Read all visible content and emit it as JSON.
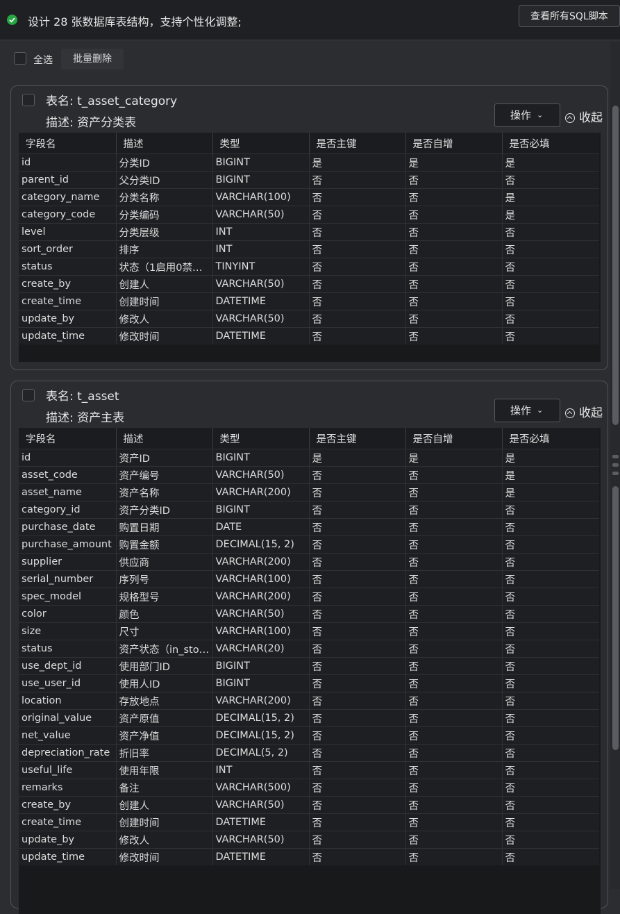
{
  "header": {
    "title": "设计 28 张数据库表结构，支持个性化调整;",
    "sql_button": "查看所有SQL脚本",
    "status_icon": "check-circle-icon",
    "status_color": "#27a644"
  },
  "toolbar": {
    "select_all": "全选",
    "batch_delete": "批量删除"
  },
  "columns": [
    "字段名",
    "描述",
    "类型",
    "是否主键",
    "是否自增",
    "是否必填"
  ],
  "tables": [
    {
      "name_label": "表名: t_asset_category",
      "desc_label": "描述: 资产分类表",
      "operate": "操作",
      "collapse": "收起",
      "rows": [
        [
          "id",
          "分类ID",
          "BIGINT",
          "是",
          "是",
          "是"
        ],
        [
          "parent_id",
          "父分类ID",
          "BIGINT",
          "否",
          "否",
          "否"
        ],
        [
          "category_name",
          "分类名称",
          "VARCHAR(100)",
          "否",
          "否",
          "是"
        ],
        [
          "category_code",
          "分类编码",
          "VARCHAR(50)",
          "否",
          "否",
          "是"
        ],
        [
          "level",
          "分类层级",
          "INT",
          "否",
          "否",
          "否"
        ],
        [
          "sort_order",
          "排序",
          "INT",
          "否",
          "否",
          "否"
        ],
        [
          "status",
          "状态（1启用0禁用…",
          "TINYINT",
          "否",
          "否",
          "否"
        ],
        [
          "create_by",
          "创建人",
          "VARCHAR(50)",
          "否",
          "否",
          "否"
        ],
        [
          "create_time",
          "创建时间",
          "DATETIME",
          "否",
          "否",
          "否"
        ],
        [
          "update_by",
          "修改人",
          "VARCHAR(50)",
          "否",
          "否",
          "否"
        ],
        [
          "update_time",
          "修改时间",
          "DATETIME",
          "否",
          "否",
          "否"
        ]
      ]
    },
    {
      "name_label": "表名: t_asset",
      "desc_label": "描述: 资产主表",
      "operate": "操作",
      "collapse": "收起",
      "rows": [
        [
          "id",
          "资产ID",
          "BIGINT",
          "是",
          "是",
          "是"
        ],
        [
          "asset_code",
          "资产编号",
          "VARCHAR(50)",
          "否",
          "否",
          "是"
        ],
        [
          "asset_name",
          "资产名称",
          "VARCHAR(200)",
          "否",
          "否",
          "是"
        ],
        [
          "category_id",
          "资产分类ID",
          "BIGINT",
          "否",
          "否",
          "否"
        ],
        [
          "purchase_date",
          "购置日期",
          "DATE",
          "否",
          "否",
          "否"
        ],
        [
          "purchase_amount",
          "购置金额",
          "DECIMAL(15, 2)",
          "否",
          "否",
          "否"
        ],
        [
          "supplier",
          "供应商",
          "VARCHAR(200)",
          "否",
          "否",
          "否"
        ],
        [
          "serial_number",
          "序列号",
          "VARCHAR(100)",
          "否",
          "否",
          "否"
        ],
        [
          "spec_model",
          "规格型号",
          "VARCHAR(200)",
          "否",
          "否",
          "否"
        ],
        [
          "color",
          "颜色",
          "VARCHAR(50)",
          "否",
          "否",
          "否"
        ],
        [
          "size",
          "尺寸",
          "VARCHAR(100)",
          "否",
          "否",
          "否"
        ],
        [
          "status",
          "资产状态（in_sto…",
          "VARCHAR(20)",
          "否",
          "否",
          "否"
        ],
        [
          "use_dept_id",
          "使用部门ID",
          "BIGINT",
          "否",
          "否",
          "否"
        ],
        [
          "use_user_id",
          "使用人ID",
          "BIGINT",
          "否",
          "否",
          "否"
        ],
        [
          "location",
          "存放地点",
          "VARCHAR(200)",
          "否",
          "否",
          "否"
        ],
        [
          "original_value",
          "资产原值",
          "DECIMAL(15, 2)",
          "否",
          "否",
          "否"
        ],
        [
          "net_value",
          "资产净值",
          "DECIMAL(15, 2)",
          "否",
          "否",
          "否"
        ],
        [
          "depreciation_rate",
          "折旧率",
          "DECIMAL(5, 2)",
          "否",
          "否",
          "否"
        ],
        [
          "useful_life",
          "使用年限",
          "INT",
          "否",
          "否",
          "否"
        ],
        [
          "remarks",
          "备注",
          "VARCHAR(500)",
          "否",
          "否",
          "否"
        ],
        [
          "create_by",
          "创建人",
          "VARCHAR(50)",
          "否",
          "否",
          "否"
        ],
        [
          "create_time",
          "创建时间",
          "DATETIME",
          "否",
          "否",
          "否"
        ],
        [
          "update_by",
          "修改人",
          "VARCHAR(50)",
          "否",
          "否",
          "否"
        ],
        [
          "update_time",
          "修改时间",
          "DATETIME",
          "否",
          "否",
          "否"
        ]
      ]
    }
  ]
}
